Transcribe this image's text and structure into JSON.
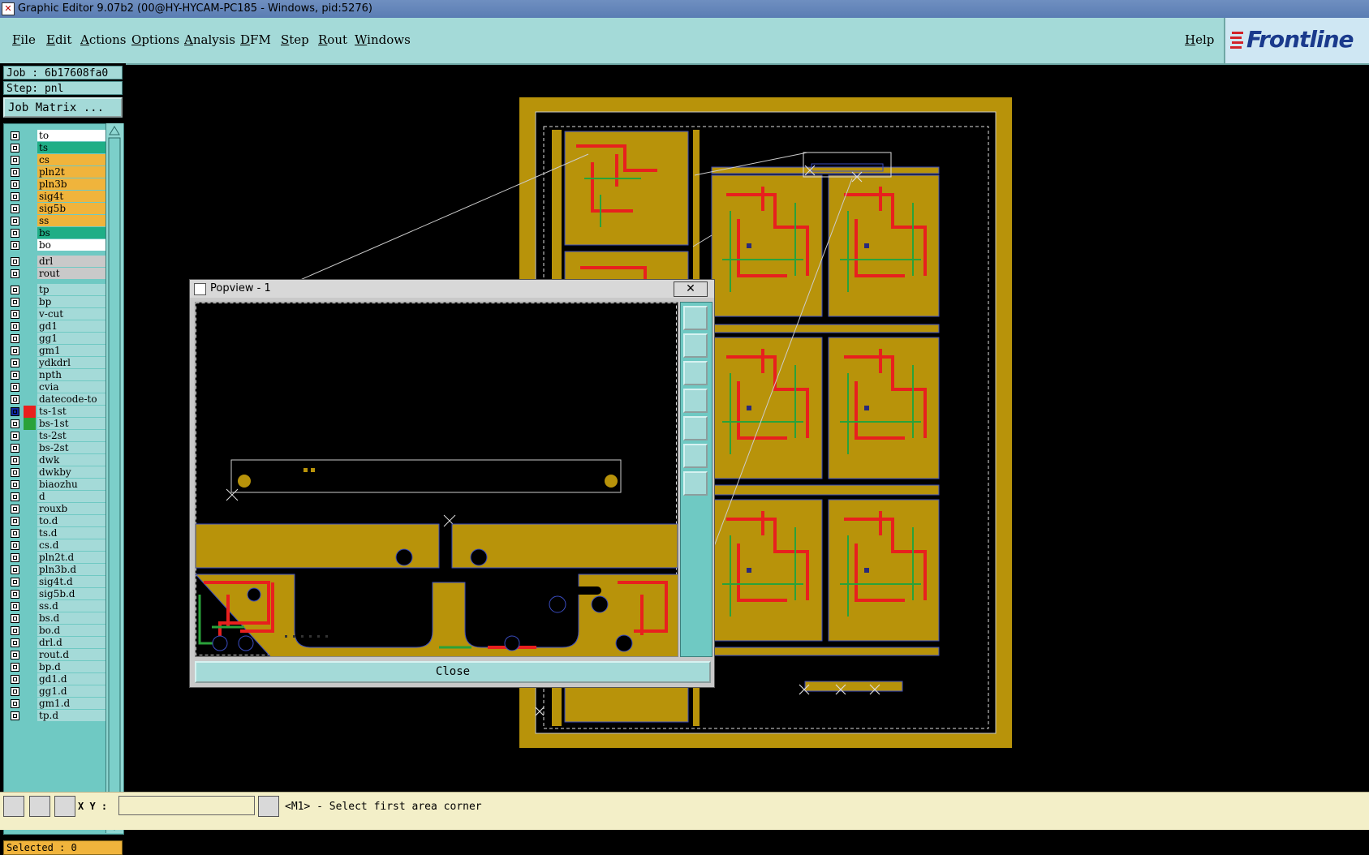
{
  "window": {
    "title": "Graphic Editor 9.07b2 (00@HY-HYCAM-PC185 - Windows, pid:5276)"
  },
  "menu": {
    "items": [
      "File",
      "Edit",
      "Actions",
      "Options",
      "Analysis",
      "DFM",
      "Step",
      "Rout",
      "Windows"
    ],
    "help": "Help",
    "logo": "Frontline"
  },
  "job": {
    "job_label": "Job : 6b17608fa0",
    "step_label": "Step: pnl",
    "matrix_button": "Job Matrix ..."
  },
  "layers": [
    {
      "name": "to",
      "color": "#ffffff"
    },
    {
      "name": "ts",
      "color": "#1fae86"
    },
    {
      "name": "cs",
      "color": "#f0b43c"
    },
    {
      "name": "pln2t",
      "color": "#f0b43c"
    },
    {
      "name": "pln3b",
      "color": "#f0b43c"
    },
    {
      "name": "sig4t",
      "color": "#f0b43c"
    },
    {
      "name": "sig5b",
      "color": "#f0b43c"
    },
    {
      "name": "ss",
      "color": "#f0b43c"
    },
    {
      "name": "bs",
      "color": "#1fae86"
    },
    {
      "name": "bo",
      "color": "#ffffff"
    },
    {
      "name": "drl",
      "color": "#c9c9c9"
    },
    {
      "name": "rout",
      "color": "#c9c9c9"
    },
    {
      "name": "tp",
      "color": "#a4dad8"
    },
    {
      "name": "bp",
      "color": "#a4dad8"
    },
    {
      "name": "v-cut",
      "color": "#a4dad8"
    },
    {
      "name": "gd1",
      "color": "#a4dad8"
    },
    {
      "name": "gg1",
      "color": "#a4dad8"
    },
    {
      "name": "gm1",
      "color": "#a4dad8"
    },
    {
      "name": "ydkdrl",
      "color": "#a4dad8"
    },
    {
      "name": "npth",
      "color": "#a4dad8"
    },
    {
      "name": "cvia",
      "color": "#a4dad8"
    },
    {
      "name": "datecode-to",
      "color": "#a4dad8"
    },
    {
      "name": "ts-1st",
      "color": "#a4dad8",
      "swatch": "#e8201e",
      "mark": "#0f2aa0"
    },
    {
      "name": "bs-1st",
      "color": "#a4dad8",
      "swatch": "#2aa23a"
    },
    {
      "name": "ts-2st",
      "color": "#a4dad8"
    },
    {
      "name": "bs-2st",
      "color": "#a4dad8"
    },
    {
      "name": "dwk",
      "color": "#a4dad8"
    },
    {
      "name": "dwkby",
      "color": "#a4dad8"
    },
    {
      "name": "biaozhu",
      "color": "#a4dad8"
    },
    {
      "name": "d",
      "color": "#a4dad8"
    },
    {
      "name": "rouxb",
      "color": "#a4dad8"
    },
    {
      "name": "to.d",
      "color": "#a4dad8"
    },
    {
      "name": "ts.d",
      "color": "#a4dad8"
    },
    {
      "name": "cs.d",
      "color": "#a4dad8"
    },
    {
      "name": "pln2t.d",
      "color": "#a4dad8"
    },
    {
      "name": "pln3b.d",
      "color": "#a4dad8"
    },
    {
      "name": "sig4t.d",
      "color": "#a4dad8"
    },
    {
      "name": "sig5b.d",
      "color": "#a4dad8"
    },
    {
      "name": "ss.d",
      "color": "#a4dad8"
    },
    {
      "name": "bs.d",
      "color": "#a4dad8"
    },
    {
      "name": "bo.d",
      "color": "#a4dad8"
    },
    {
      "name": "drl.d",
      "color": "#a4dad8"
    },
    {
      "name": "rout.d",
      "color": "#a4dad8"
    },
    {
      "name": "bp.d",
      "color": "#a4dad8"
    },
    {
      "name": "gd1.d",
      "color": "#a4dad8"
    },
    {
      "name": "gg1.d",
      "color": "#a4dad8"
    },
    {
      "name": "gm1.d",
      "color": "#a4dad8"
    },
    {
      "name": "tp.d",
      "color": "#a4dad8"
    }
  ],
  "selected": "Selected : 0",
  "statusbar": {
    "xy_label": "X Y :",
    "xy_value": "",
    "message": "<M1> - Select first area corner"
  },
  "popview": {
    "title": "Popview - 1",
    "close_label": "Close",
    "close_x": "✕"
  },
  "colors": {
    "copper": "#b8930a",
    "trace_red": "#e8201e",
    "trace_green": "#2aa23a",
    "outline_blue": "#3a4cc0",
    "panel_bg": "#a4dad8"
  }
}
